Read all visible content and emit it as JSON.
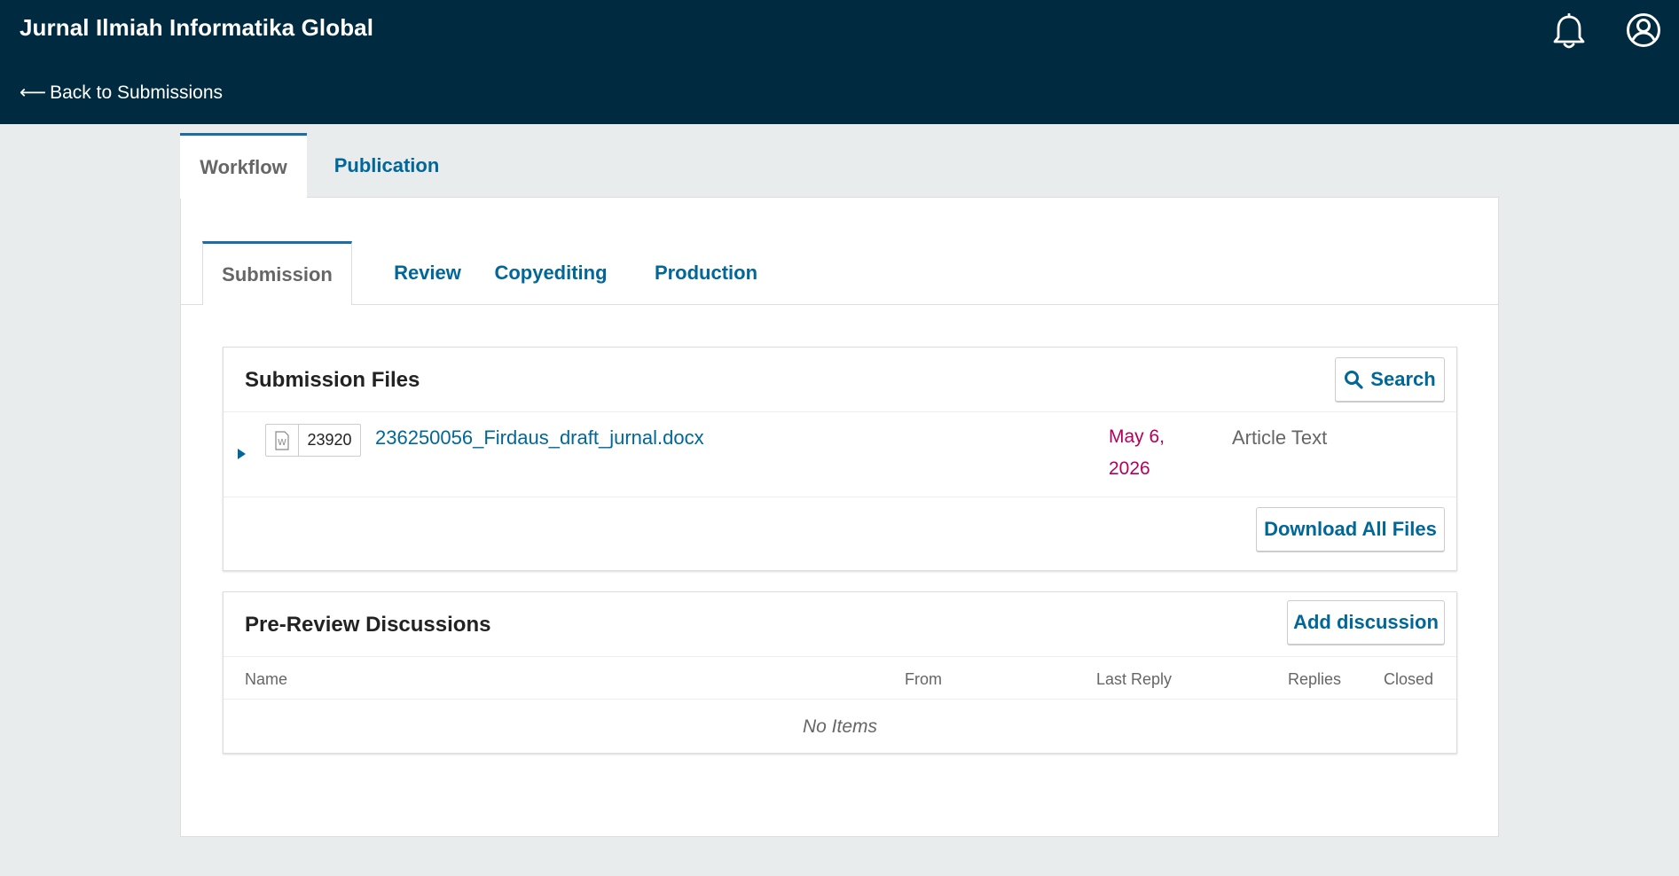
{
  "header": {
    "site_title": "Jurnal Ilmiah Informatika Global",
    "back_label": "Back to Submissions",
    "back_arrow": "⟵",
    "icons": [
      "bell-icon",
      "user-icon"
    ]
  },
  "outer_tabs": [
    {
      "label": "Workflow",
      "active": true
    },
    {
      "label": "Publication",
      "active": false
    }
  ],
  "inner_tabs": [
    {
      "label": "Submission",
      "active": true
    },
    {
      "label": "Review",
      "active": false
    },
    {
      "label": "Copyediting",
      "active": false
    },
    {
      "label": "Production",
      "active": false
    }
  ],
  "submission_files": {
    "title": "Submission Files",
    "search_label": "Search",
    "files": [
      {
        "id": "23920",
        "name": "236250056_Firdaus_draft_jurnal.docx",
        "date": "May 6, 2026",
        "type": "Article Text",
        "icon": "word-doc-icon"
      }
    ],
    "download_all_label": "Download All Files"
  },
  "discussions": {
    "title": "Pre-Review Discussions",
    "add_label": "Add discussion",
    "columns": [
      "Name",
      "From",
      "Last Reply",
      "Replies",
      "Closed"
    ],
    "empty_text": "No Items"
  },
  "colors": {
    "header_bg": "#002a3f",
    "link": "#006798",
    "active_tab_border": "#1b6da3",
    "date": "#b5005b",
    "page_bg": "#e9ecec"
  }
}
